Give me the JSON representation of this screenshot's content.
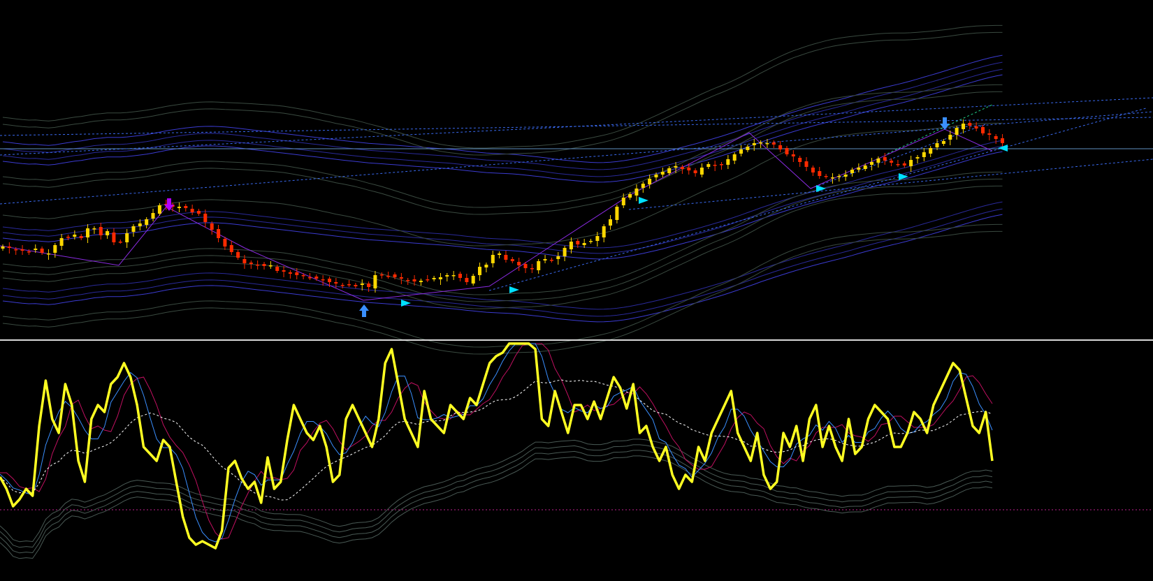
{
  "colors": {
    "background": "#000000",
    "bull_candle": "#ffd700",
    "bear_candle": "#ff2a00",
    "pane_separator": "#d8d8d8",
    "hline": "#5f8fbf",
    "band_blue": "#2a2a9a",
    "band_blue_light": "#3b3bd0",
    "band_gray": "#3a4a40",
    "trend_dotted": "#3a6af0",
    "zigzag": "#8a2be2",
    "arrow_up": "#3a8fff",
    "arrow_down_blue": "#3a8fff",
    "arrow_down_purple": "#b000ff",
    "marker_cyan": "#00e0ff",
    "osc_main": "#ffff22",
    "osc_blue": "#3a8fff",
    "osc_red": "#c01060",
    "osc_signal": "#ffffff",
    "osc_gray": "#4a5a55",
    "osc_level": "#c02090"
  },
  "main_pane": {
    "closes": [
      353,
      355,
      358,
      359,
      360,
      356,
      362,
      363,
      351,
      341,
      339,
      336,
      341,
      327,
      327,
      337,
      331,
      347,
      346,
      334,
      324,
      320,
      314,
      305,
      294,
      293,
      296,
      296,
      298,
      304,
      306,
      318,
      329,
      341,
      353,
      361,
      369,
      377,
      378,
      380,
      381,
      380,
      388,
      389,
      392,
      394,
      395,
      397,
      399,
      401,
      404,
      406,
      408,
      407,
      410,
      406,
      411,
      394,
      394,
      395,
      397,
      399,
      401,
      403,
      402,
      400,
      398,
      397,
      394,
      394,
      398,
      404,
      395,
      382,
      379,
      365,
      363,
      372,
      374,
      380,
      384,
      385,
      374,
      371,
      373,
      367,
      355,
      346,
      350,
      348,
      345,
      338,
      324,
      314,
      296,
      283,
      278,
      270,
      263,
      256,
      250,
      246,
      241,
      238,
      242,
      244,
      248,
      240,
      235,
      237,
      236,
      228,
      221,
      214,
      210,
      205,
      204,
      205,
      207,
      214,
      221,
      224,
      232,
      239,
      247,
      252,
      253,
      254,
      252,
      250,
      243,
      240,
      237,
      232,
      227,
      230,
      233,
      235,
      237,
      229,
      225,
      218,
      212,
      205,
      202,
      193,
      183,
      177,
      180,
      184,
      191,
      193,
      199,
      205
    ]
  },
  "markers": {
    "arrow_up": "up-arrow-icon",
    "arrow_down": "down-arrow-icon",
    "triangle": "right-triangle-icon",
    "triangle_left": "left-triangle-icon"
  },
  "oscillator_pane": {
    "values": [
      683,
      700,
      725,
      715,
      700,
      710,
      610,
      545,
      600,
      620,
      550,
      580,
      660,
      690,
      600,
      580,
      590,
      550,
      540,
      520,
      540,
      580,
      640,
      650,
      660,
      630,
      640,
      690,
      740,
      770,
      780,
      775,
      780,
      785,
      760,
      670,
      660,
      685,
      700,
      690,
      720,
      655,
      700,
      690,
      630,
      580,
      600,
      620,
      630,
      610,
      640,
      690,
      680,
      600,
      580,
      600,
      620,
      640,
      600,
      520,
      500,
      550,
      600,
      620,
      640,
      560,
      600,
      610,
      620,
      580,
      590,
      600,
      570,
      580,
      550,
      520,
      510,
      505,
      490,
      480,
      478,
      479,
      500,
      600,
      610,
      560,
      590,
      620,
      580,
      580,
      600,
      575,
      600,
      570,
      540,
      555,
      585,
      550,
      620,
      610,
      640,
      660,
      640,
      680,
      700,
      680,
      690,
      640,
      660,
      620,
      600,
      580,
      560,
      620,
      640,
      660,
      620,
      680,
      700,
      690,
      620,
      640,
      610,
      660,
      600,
      580,
      640,
      610,
      640,
      660,
      600,
      650,
      640,
      600,
      580,
      590,
      600,
      640,
      640,
      620,
      590,
      600,
      620,
      580,
      560,
      540,
      520,
      530,
      570,
      610,
      620,
      590,
      660
    ]
  }
}
